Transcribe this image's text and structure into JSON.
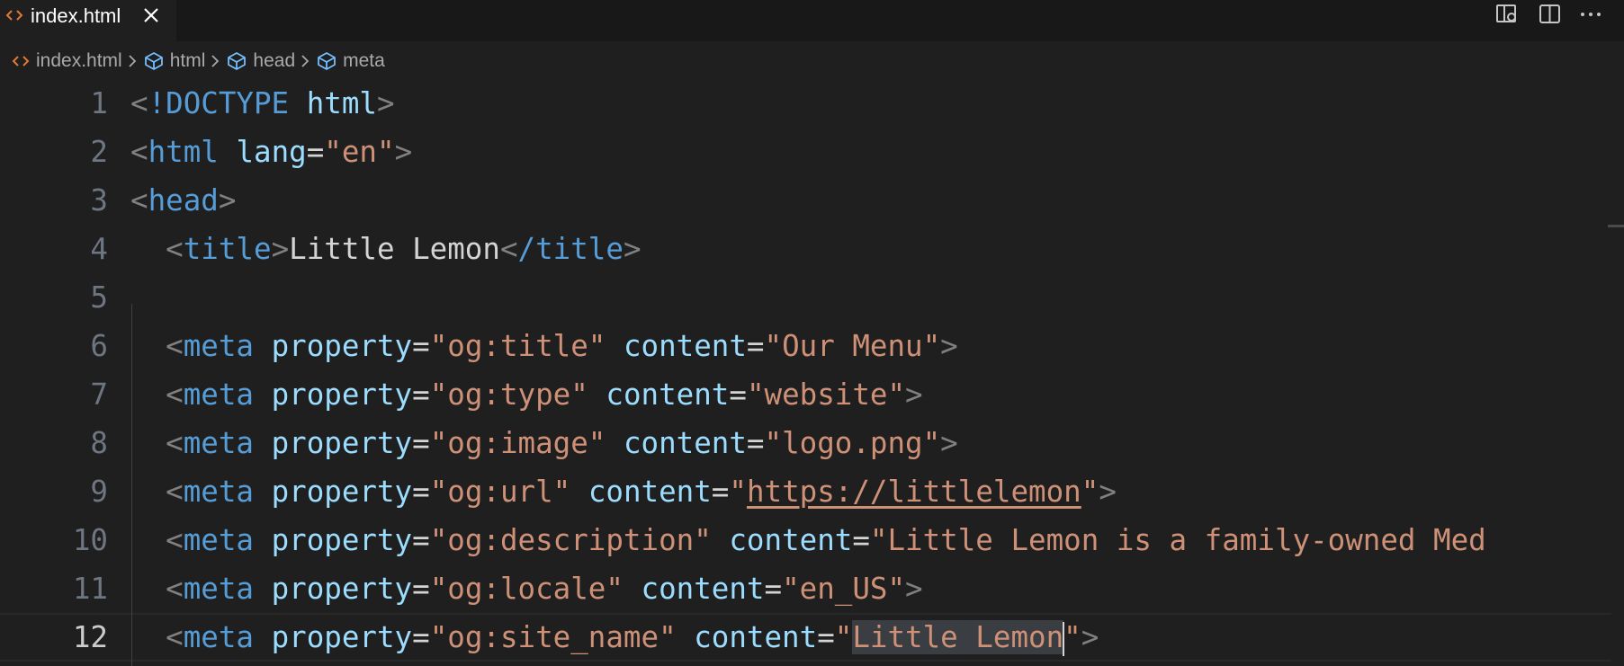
{
  "tab": {
    "label": "index.html",
    "icon": "html-file-icon",
    "close_icon": "close-icon"
  },
  "editor_actions": [
    "open-changes-icon",
    "split-editor-icon",
    "more-actions-icon"
  ],
  "breadcrumb": {
    "file": "index.html",
    "items": [
      "html",
      "head",
      "meta"
    ]
  },
  "editor": {
    "active_line": 12,
    "lines": [
      {
        "n": "1"
      },
      {
        "n": "2"
      },
      {
        "n": "3"
      },
      {
        "n": "4"
      },
      {
        "n": "5"
      },
      {
        "n": "6"
      },
      {
        "n": "7"
      },
      {
        "n": "8"
      },
      {
        "n": "9"
      },
      {
        "n": "10"
      },
      {
        "n": "11"
      },
      {
        "n": "12"
      }
    ],
    "code": {
      "l1": {
        "doctype": "!DOCTYPE",
        "name": "html"
      },
      "l2": {
        "tag": "html",
        "attr": "lang",
        "value": "\"en\""
      },
      "l3": {
        "tag": "head"
      },
      "l4": {
        "tag": "title",
        "text": "Little Lemon",
        "close": "/title"
      },
      "l6": {
        "tag": "meta",
        "a1": "property",
        "v1": "\"og:title\"",
        "a2": "content",
        "v2": "\"Our Menu\""
      },
      "l7": {
        "tag": "meta",
        "a1": "property",
        "v1": "\"og:type\"",
        "a2": "content",
        "v2": "\"website\""
      },
      "l8": {
        "tag": "meta",
        "a1": "property",
        "v1": "\"og:image\"",
        "a2": "content",
        "v2": "\"logo.png\""
      },
      "l9": {
        "tag": "meta",
        "a1": "property",
        "v1": "\"og:url\"",
        "a2": "content",
        "q_open": "\"",
        "link": "https://littlelemon",
        "q_close": "\""
      },
      "l10": {
        "tag": "meta",
        "a1": "property",
        "v1": "\"og:description\"",
        "a2": "content",
        "v2": "\"Little Lemon is a family-owned Med"
      },
      "l11": {
        "tag": "meta",
        "a1": "property",
        "v1": "\"og:locale\"",
        "a2": "content",
        "v2": "\"en_US\""
      },
      "l12": {
        "tag": "meta",
        "a1": "property",
        "v1": "\"og:site_name\"",
        "a2": "content",
        "q_open": "\"",
        "selected": "Little Lemon",
        "q_close": "\""
      }
    }
  },
  "colors": {
    "background": "#1f1f1f",
    "tag": "#569cd6",
    "attribute": "#9cdcfe",
    "string": "#ce9178",
    "punctuation": "#808080",
    "html_icon": "#e37933"
  }
}
